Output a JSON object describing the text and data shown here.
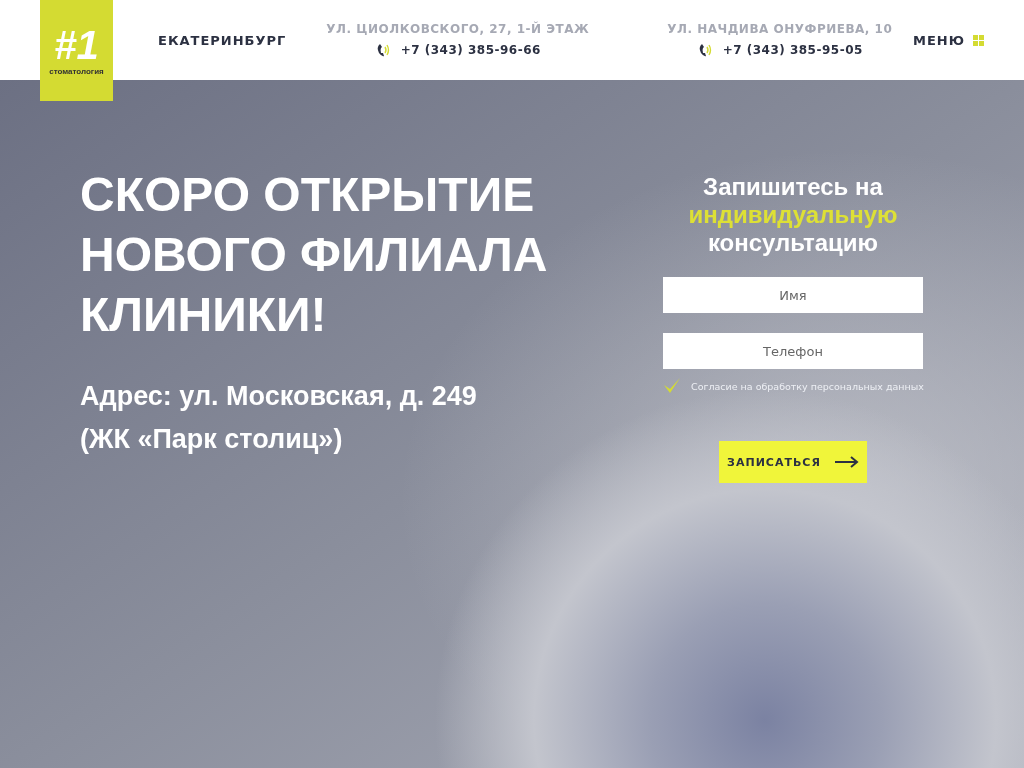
{
  "header": {
    "logo": {
      "mark": "#1",
      "caption": "стоматология"
    },
    "city": "ЕКАТЕРИНБУРГ",
    "branches": [
      {
        "address": "УЛ. ЦИОЛКОВСКОГО, 27, 1-Й ЭТАЖ",
        "phone": "+7 (343) 385-96-66"
      },
      {
        "address": "УЛ. НАЧДИВА ОНУФРИЕВА, 10",
        "phone": "+7 (343) 385-95-05"
      }
    ],
    "menu": "МЕНЮ"
  },
  "hero": {
    "title": "СКОРО ОТКРЫТИЕ НОВОГО ФИЛИАЛА КЛИНИКИ!",
    "address": "Адрес: ул. Московская, д. 249 (ЖК «Парк столиц»)"
  },
  "form": {
    "title": "Запишитесь на **индивидуальную** консультацию",
    "fields": [
      {
        "placeholder": "Имя"
      },
      {
        "placeholder": "Телефон"
      }
    ],
    "consent": {
      "label": "Согласие на обработку персональных данных",
      "checked": true
    },
    "submit": "ЗАПИСАТЬСЯ"
  }
}
